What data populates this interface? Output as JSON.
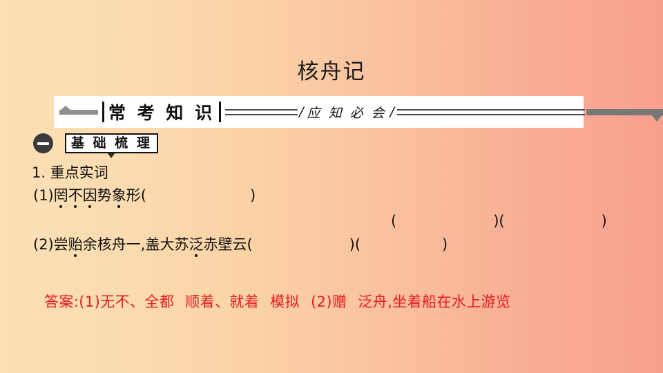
{
  "slide": {
    "title": "核舟记",
    "background": {
      "from": "#fbdfb5",
      "to": "#f7a08d",
      "direction": "left-to-right"
    }
  },
  "banner": {
    "main_label": "常 考 知 识",
    "sub_label": "应 知 必 会",
    "slash_left": "/",
    "slash_right": "/",
    "lead_icon": "up-triangle-icon",
    "tail_icon": "down-triangle-icon"
  },
  "section": {
    "toggle_icon": "minus-circle-icon",
    "label": "基 础 梳 理",
    "pointer_icon": "down-caret-icon"
  },
  "content": {
    "heading": "1. 重点实词",
    "items": [
      {
        "number": "(1)",
        "chars": [
          {
            "ch": "罔",
            "dot": true
          },
          {
            "ch": "不",
            "dot": true
          },
          {
            "ch": "因",
            "dot": true
          },
          {
            "ch": "势",
            "dot": false
          },
          {
            "ch": "象",
            "dot": true
          },
          {
            "ch": "形",
            "dot": false
          }
        ],
        "paren_open": "(",
        "paren_close": ")"
      },
      {
        "number": "(2)",
        "chars": [
          {
            "ch": "尝",
            "dot": false
          },
          {
            "ch": "贻",
            "dot": true
          },
          {
            "ch": "余",
            "dot": false
          },
          {
            "ch": "核",
            "dot": false
          },
          {
            "ch": "舟",
            "dot": false
          },
          {
            "ch": "一",
            "dot": false
          },
          {
            "ch": ",",
            "dot": false
          },
          {
            "ch": "盖",
            "dot": false
          },
          {
            "ch": "大",
            "dot": false
          },
          {
            "ch": "苏",
            "dot": false
          },
          {
            "ch": "泛",
            "dot": true
          },
          {
            "ch": "赤",
            "dot": false
          },
          {
            "ch": "壁",
            "dot": false
          },
          {
            "ch": "云",
            "dot": false
          }
        ],
        "paren_open": "(",
        "paren_close": ")"
      }
    ],
    "extra_blanks_row": {
      "pair1_open": "(",
      "pair1_close": ")",
      "pair2_open": "(",
      "pair2_close": ")"
    },
    "item2_blanks": {
      "pair1_close": ")",
      "pair2_open": "(",
      "pair2_close": ")"
    }
  },
  "answer": {
    "color": "#e8191b",
    "label": "答案:",
    "part1_number": "(1)",
    "part1_a": "无不、全都",
    "part1_b": "顺着、就着",
    "part1_c": "模拟",
    "part2_number": "(2)",
    "part2_a": "赠",
    "part2_b": "泛舟,坐着船在水上游览"
  }
}
